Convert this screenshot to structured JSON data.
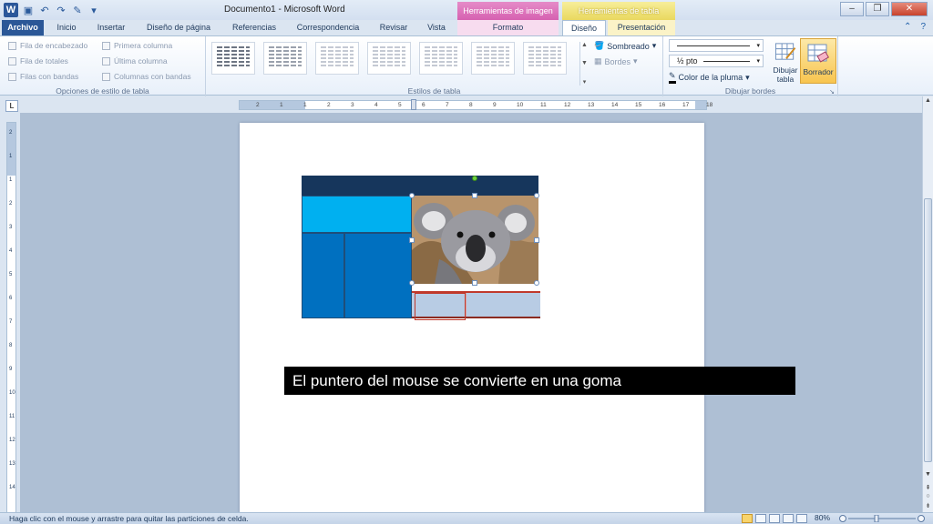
{
  "window": {
    "title": "Documento1  -  Microsoft Word",
    "ctx_image": "Herramientas de imagen",
    "ctx_table": "Herramientas de tabla",
    "buttons": [
      "minimize",
      "restore",
      "close"
    ]
  },
  "quick_access": {
    "app_icon": "W"
  },
  "tabs": [
    "Archivo",
    "Inicio",
    "Insertar",
    "Diseño de página",
    "Referencias",
    "Correspondencia",
    "Revisar",
    "Vista",
    "Formato",
    "Diseño",
    "Presentación"
  ],
  "active_tab": "Diseño",
  "ribbon": {
    "table_style_options": {
      "label": "Opciones de estilo de tabla",
      "checks": [
        "Fila de encabezado",
        "Primera columna",
        "Fila de totales",
        "Última columna",
        "Filas con bandas",
        "Columnas con bandas"
      ]
    },
    "table_styles": {
      "label": "Estilos de tabla"
    },
    "shading": "Sombreado",
    "borders": "Bordes",
    "draw_borders": {
      "label": "Dibujar bordes",
      "pen_weight": "½ pto",
      "pen_color": "Color de la pluma",
      "draw_table": "Dibujar tabla",
      "eraser": "Borrador"
    }
  },
  "ruler": {
    "labels": [
      "2",
      "1",
      "1",
      "2",
      "3",
      "4",
      "5",
      "6",
      "7",
      "8",
      "9",
      "10",
      "11",
      "12",
      "13",
      "14",
      "15",
      "16",
      "17",
      "18"
    ]
  },
  "caption": "El puntero del mouse se convierte en una goma",
  "status": {
    "message": "Haga clic con el mouse y arrastre para quitar las particiones de celda.",
    "zoom": "80%"
  },
  "colors": {
    "table_header": "#16365c",
    "cell_light": "#00b0f0",
    "cell_blue": "#0070c0",
    "cell_pale": "#b8cce4",
    "eraser_highlight": "#c0392b"
  }
}
